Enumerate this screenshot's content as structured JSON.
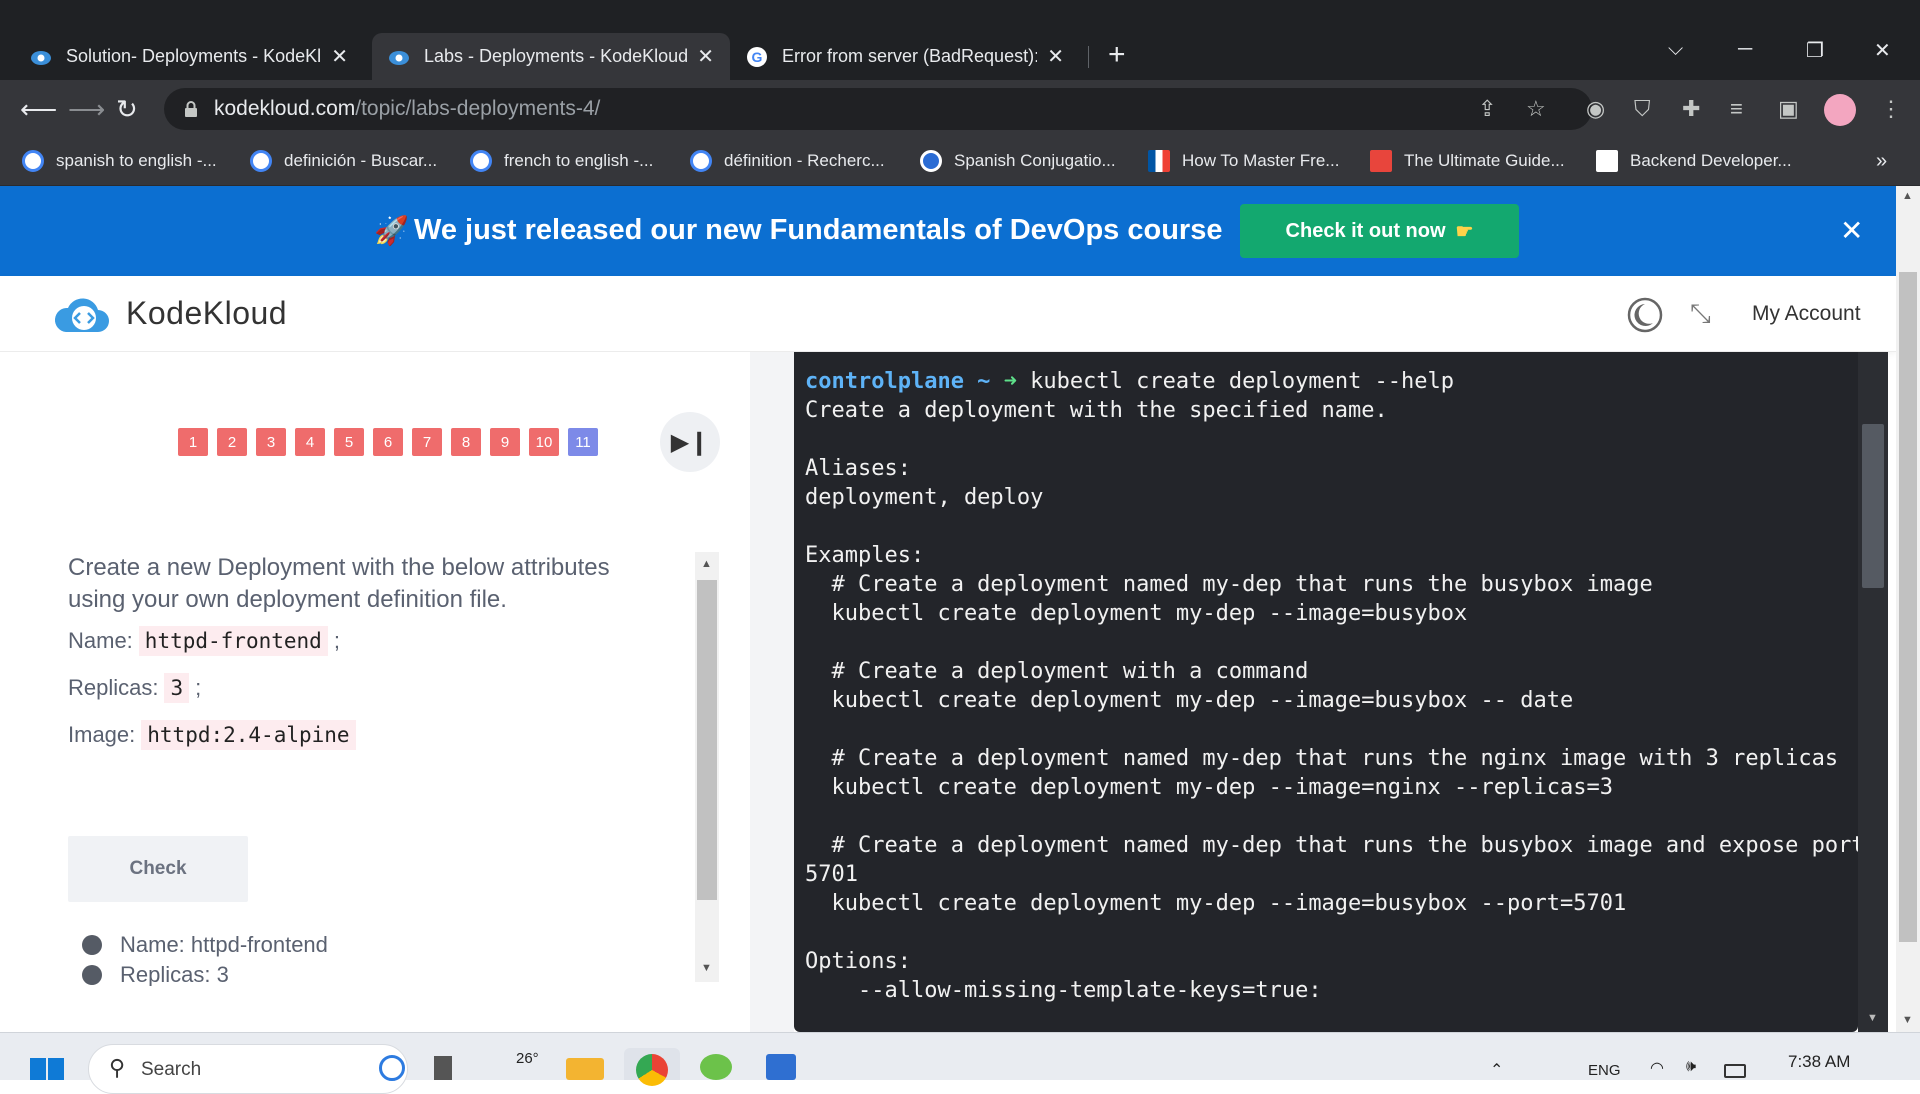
{
  "browser": {
    "tabs": [
      {
        "title": "Solution- Deployments - KodeKl",
        "close": "✕",
        "active": false
      },
      {
        "title": "Labs - Deployments - KodeKloud",
        "close": "✕",
        "active": true
      },
      {
        "title": "Error from server (BadRequest): e",
        "close": "✕",
        "active": false
      }
    ],
    "new_tab": "+",
    "address": {
      "host": "kodekloud.com",
      "path": "/topic/labs-deployments-4/"
    },
    "bookmarks": [
      {
        "label": "spanish to english -...",
        "icon": "google-icon"
      },
      {
        "label": "definición - Buscar...",
        "icon": "google-icon"
      },
      {
        "label": "french to english -...",
        "icon": "google-icon"
      },
      {
        "label": "définition - Recherc...",
        "icon": "google-icon"
      },
      {
        "label": "Spanish Conjugatio...",
        "icon": "spanishdict-icon"
      },
      {
        "label": "How To Master Fre...",
        "icon": "french-flag-icon"
      },
      {
        "label": "The Ultimate Guide...",
        "icon": "j-icon"
      },
      {
        "label": "Backend Developer...",
        "icon": "r-icon"
      }
    ],
    "bookmarks_more": "»"
  },
  "banner": {
    "text": "We just released our new Fundamentals of DevOps course",
    "button": "Check it out now",
    "close": "✕"
  },
  "header": {
    "logo": "KodeKloud",
    "account": "My Account"
  },
  "lab": {
    "steps": [
      "1",
      "2",
      "3",
      "4",
      "5",
      "6",
      "7",
      "8",
      "9",
      "10",
      "11"
    ],
    "current_step": "11",
    "task": "Create a new Deployment with the below attributes using your own deployment definition file.",
    "attributes": [
      {
        "label": "Name:",
        "value": "httpd-frontend",
        "suffix": ";"
      },
      {
        "label": "Replicas:",
        "value": "3",
        "suffix": ";"
      },
      {
        "label": "Image:",
        "value": "httpd:2.4-alpine",
        "suffix": ""
      }
    ],
    "check_button": "Check",
    "checks": [
      "Name: httpd-frontend",
      "Replicas: 3"
    ]
  },
  "terminal": {
    "prompt": "controlplane ~",
    "prompt_arrow": "➜",
    "command": " kubectl create deployment --help",
    "output": [
      "Create a deployment with the specified name.",
      "",
      "Aliases:",
      "deployment, deploy",
      "",
      "Examples:",
      "  # Create a deployment named my-dep that runs the busybox image",
      "  kubectl create deployment my-dep --image=busybox",
      "",
      "  # Create a deployment with a command",
      "  kubectl create deployment my-dep --image=busybox -- date",
      "",
      "  # Create a deployment named my-dep that runs the nginx image with 3 replicas",
      "  kubectl create deployment my-dep --image=nginx --replicas=3",
      "",
      "  # Create a deployment named my-dep that runs the busybox image and expose port",
      "5701",
      "  kubectl create deployment my-dep --image=busybox --port=5701",
      "",
      "Options:",
      "    --allow-missing-template-keys=true:"
    ]
  },
  "taskbar": {
    "search_placeholder": "Search",
    "weather": "26°",
    "language": "ENG",
    "time": "7:38 AM"
  }
}
